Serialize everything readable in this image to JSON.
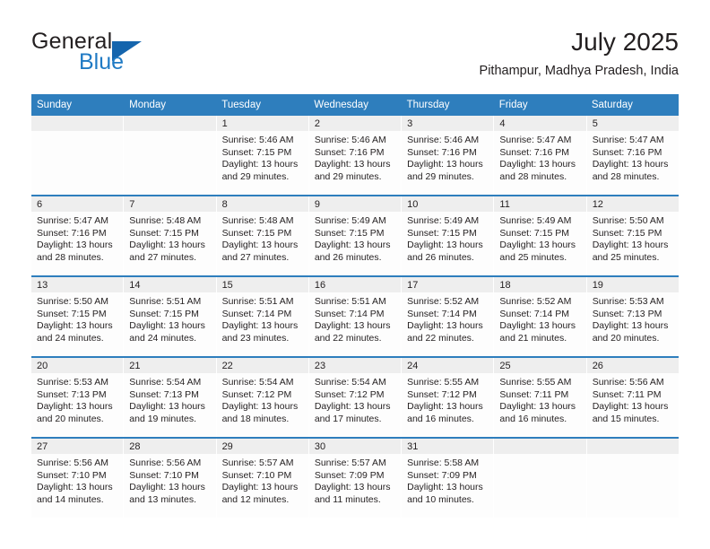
{
  "brand": {
    "word_one": "General",
    "word_two": "Blue",
    "logo_icon": "triangle-logo-icon"
  },
  "header": {
    "month_title": "July 2025",
    "location": "Pithampur, Madhya Pradesh, India"
  },
  "colors": {
    "header_blue": "#2e7ebd",
    "brand_blue": "#1f7ac4",
    "logo_blue": "#1565ad",
    "day_number_bg": "#eeeeee",
    "text": "#231f20"
  },
  "weekdays": [
    "Sunday",
    "Monday",
    "Tuesday",
    "Wednesday",
    "Thursday",
    "Friday",
    "Saturday"
  ],
  "weeks": [
    [
      {
        "day": "",
        "empty": true
      },
      {
        "day": "",
        "empty": true
      },
      {
        "day": "1",
        "sunrise": "Sunrise: 5:46 AM",
        "sunset": "Sunset: 7:15 PM",
        "daylight_1": "Daylight: 13 hours",
        "daylight_2": "and 29 minutes."
      },
      {
        "day": "2",
        "sunrise": "Sunrise: 5:46 AM",
        "sunset": "Sunset: 7:16 PM",
        "daylight_1": "Daylight: 13 hours",
        "daylight_2": "and 29 minutes."
      },
      {
        "day": "3",
        "sunrise": "Sunrise: 5:46 AM",
        "sunset": "Sunset: 7:16 PM",
        "daylight_1": "Daylight: 13 hours",
        "daylight_2": "and 29 minutes."
      },
      {
        "day": "4",
        "sunrise": "Sunrise: 5:47 AM",
        "sunset": "Sunset: 7:16 PM",
        "daylight_1": "Daylight: 13 hours",
        "daylight_2": "and 28 minutes."
      },
      {
        "day": "5",
        "sunrise": "Sunrise: 5:47 AM",
        "sunset": "Sunset: 7:16 PM",
        "daylight_1": "Daylight: 13 hours",
        "daylight_2": "and 28 minutes."
      }
    ],
    [
      {
        "day": "6",
        "sunrise": "Sunrise: 5:47 AM",
        "sunset": "Sunset: 7:16 PM",
        "daylight_1": "Daylight: 13 hours",
        "daylight_2": "and 28 minutes."
      },
      {
        "day": "7",
        "sunrise": "Sunrise: 5:48 AM",
        "sunset": "Sunset: 7:15 PM",
        "daylight_1": "Daylight: 13 hours",
        "daylight_2": "and 27 minutes."
      },
      {
        "day": "8",
        "sunrise": "Sunrise: 5:48 AM",
        "sunset": "Sunset: 7:15 PM",
        "daylight_1": "Daylight: 13 hours",
        "daylight_2": "and 27 minutes."
      },
      {
        "day": "9",
        "sunrise": "Sunrise: 5:49 AM",
        "sunset": "Sunset: 7:15 PM",
        "daylight_1": "Daylight: 13 hours",
        "daylight_2": "and 26 minutes."
      },
      {
        "day": "10",
        "sunrise": "Sunrise: 5:49 AM",
        "sunset": "Sunset: 7:15 PM",
        "daylight_1": "Daylight: 13 hours",
        "daylight_2": "and 26 minutes."
      },
      {
        "day": "11",
        "sunrise": "Sunrise: 5:49 AM",
        "sunset": "Sunset: 7:15 PM",
        "daylight_1": "Daylight: 13 hours",
        "daylight_2": "and 25 minutes."
      },
      {
        "day": "12",
        "sunrise": "Sunrise: 5:50 AM",
        "sunset": "Sunset: 7:15 PM",
        "daylight_1": "Daylight: 13 hours",
        "daylight_2": "and 25 minutes."
      }
    ],
    [
      {
        "day": "13",
        "sunrise": "Sunrise: 5:50 AM",
        "sunset": "Sunset: 7:15 PM",
        "daylight_1": "Daylight: 13 hours",
        "daylight_2": "and 24 minutes."
      },
      {
        "day": "14",
        "sunrise": "Sunrise: 5:51 AM",
        "sunset": "Sunset: 7:15 PM",
        "daylight_1": "Daylight: 13 hours",
        "daylight_2": "and 24 minutes."
      },
      {
        "day": "15",
        "sunrise": "Sunrise: 5:51 AM",
        "sunset": "Sunset: 7:14 PM",
        "daylight_1": "Daylight: 13 hours",
        "daylight_2": "and 23 minutes."
      },
      {
        "day": "16",
        "sunrise": "Sunrise: 5:51 AM",
        "sunset": "Sunset: 7:14 PM",
        "daylight_1": "Daylight: 13 hours",
        "daylight_2": "and 22 minutes."
      },
      {
        "day": "17",
        "sunrise": "Sunrise: 5:52 AM",
        "sunset": "Sunset: 7:14 PM",
        "daylight_1": "Daylight: 13 hours",
        "daylight_2": "and 22 minutes."
      },
      {
        "day": "18",
        "sunrise": "Sunrise: 5:52 AM",
        "sunset": "Sunset: 7:14 PM",
        "daylight_1": "Daylight: 13 hours",
        "daylight_2": "and 21 minutes."
      },
      {
        "day": "19",
        "sunrise": "Sunrise: 5:53 AM",
        "sunset": "Sunset: 7:13 PM",
        "daylight_1": "Daylight: 13 hours",
        "daylight_2": "and 20 minutes."
      }
    ],
    [
      {
        "day": "20",
        "sunrise": "Sunrise: 5:53 AM",
        "sunset": "Sunset: 7:13 PM",
        "daylight_1": "Daylight: 13 hours",
        "daylight_2": "and 20 minutes."
      },
      {
        "day": "21",
        "sunrise": "Sunrise: 5:54 AM",
        "sunset": "Sunset: 7:13 PM",
        "daylight_1": "Daylight: 13 hours",
        "daylight_2": "and 19 minutes."
      },
      {
        "day": "22",
        "sunrise": "Sunrise: 5:54 AM",
        "sunset": "Sunset: 7:12 PM",
        "daylight_1": "Daylight: 13 hours",
        "daylight_2": "and 18 minutes."
      },
      {
        "day": "23",
        "sunrise": "Sunrise: 5:54 AM",
        "sunset": "Sunset: 7:12 PM",
        "daylight_1": "Daylight: 13 hours",
        "daylight_2": "and 17 minutes."
      },
      {
        "day": "24",
        "sunrise": "Sunrise: 5:55 AM",
        "sunset": "Sunset: 7:12 PM",
        "daylight_1": "Daylight: 13 hours",
        "daylight_2": "and 16 minutes."
      },
      {
        "day": "25",
        "sunrise": "Sunrise: 5:55 AM",
        "sunset": "Sunset: 7:11 PM",
        "daylight_1": "Daylight: 13 hours",
        "daylight_2": "and 16 minutes."
      },
      {
        "day": "26",
        "sunrise": "Sunrise: 5:56 AM",
        "sunset": "Sunset: 7:11 PM",
        "daylight_1": "Daylight: 13 hours",
        "daylight_2": "and 15 minutes."
      }
    ],
    [
      {
        "day": "27",
        "sunrise": "Sunrise: 5:56 AM",
        "sunset": "Sunset: 7:10 PM",
        "daylight_1": "Daylight: 13 hours",
        "daylight_2": "and 14 minutes."
      },
      {
        "day": "28",
        "sunrise": "Sunrise: 5:56 AM",
        "sunset": "Sunset: 7:10 PM",
        "daylight_1": "Daylight: 13 hours",
        "daylight_2": "and 13 minutes."
      },
      {
        "day": "29",
        "sunrise": "Sunrise: 5:57 AM",
        "sunset": "Sunset: 7:10 PM",
        "daylight_1": "Daylight: 13 hours",
        "daylight_2": "and 12 minutes."
      },
      {
        "day": "30",
        "sunrise": "Sunrise: 5:57 AM",
        "sunset": "Sunset: 7:09 PM",
        "daylight_1": "Daylight: 13 hours",
        "daylight_2": "and 11 minutes."
      },
      {
        "day": "31",
        "sunrise": "Sunrise: 5:58 AM",
        "sunset": "Sunset: 7:09 PM",
        "daylight_1": "Daylight: 13 hours",
        "daylight_2": "and 10 minutes."
      },
      {
        "day": "",
        "empty": true
      },
      {
        "day": "",
        "empty": true
      }
    ]
  ]
}
